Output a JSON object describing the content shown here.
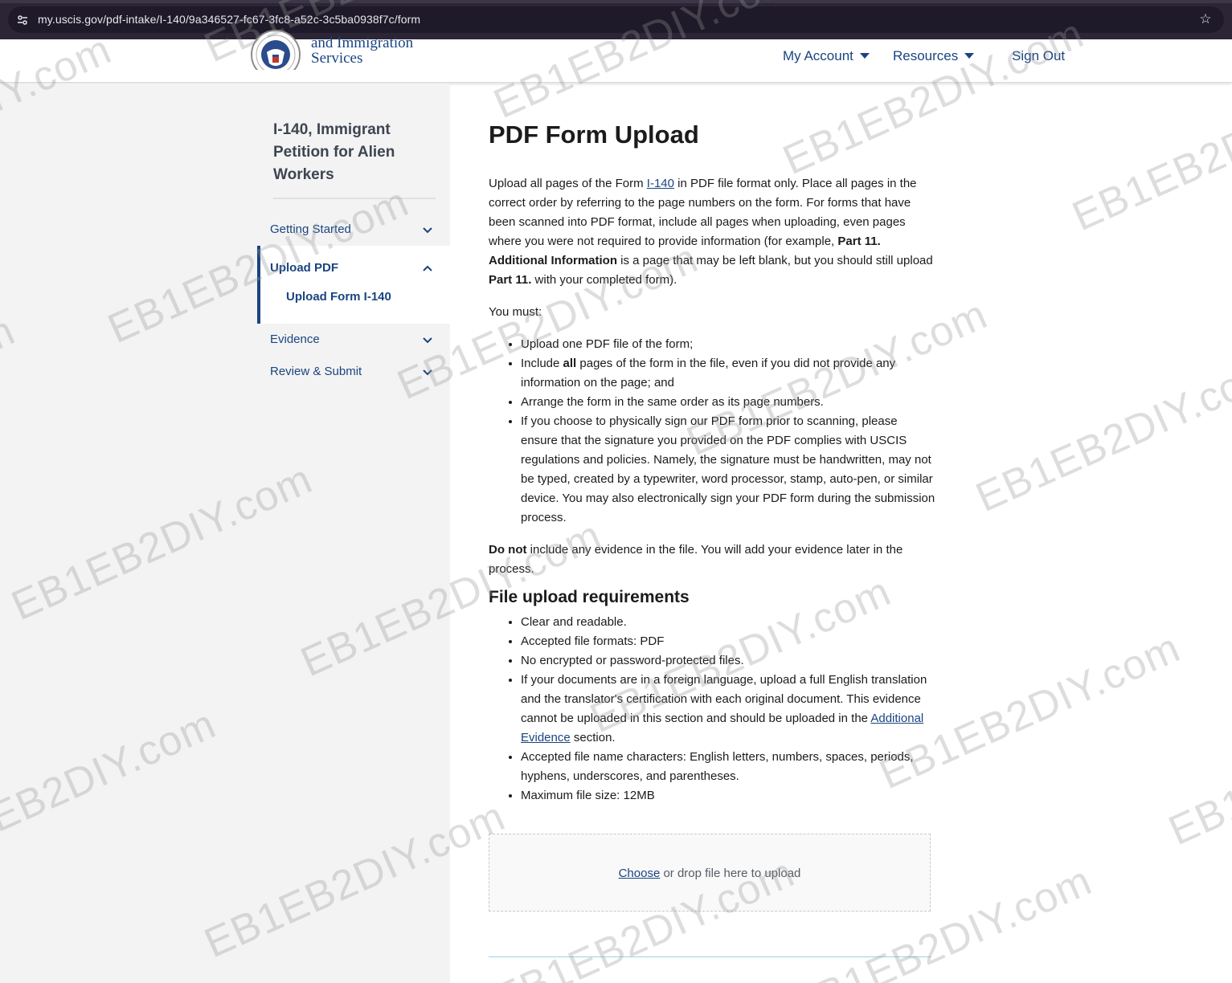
{
  "browser": {
    "url": "my.uscis.gov/pdf-intake/I-140/9a346527-fc67-3fc8-a52c-3c5ba0938f7c/form"
  },
  "header": {
    "logo_line1": "and Immigration",
    "logo_line2": "Services",
    "nav": {
      "my_account": "My Account",
      "resources": "Resources",
      "sign_out": "Sign Out"
    }
  },
  "sidebar": {
    "title": "I-140, Immigrant Petition for Alien Workers",
    "items": [
      {
        "label": "Getting Started"
      },
      {
        "label": "Upload PDF",
        "sub": "Upload Form I-140"
      },
      {
        "label": "Evidence"
      },
      {
        "label": "Review & Submit"
      }
    ]
  },
  "main": {
    "title": "PDF Form Upload",
    "intro": {
      "t1": "Upload all pages of the Form ",
      "link": "I-140",
      "t2": " in PDF file format only. Place all pages in the correct order by referring to the page numbers on the form. For forms that have been scanned into PDF format, include all pages when uploading, even pages where you were not required to provide information (for example, ",
      "b1": "Part 11. Additional Information",
      "t3": " is a page that may be left blank, but you should still upload ",
      "b2": "Part 11.",
      "t4": " with your completed form)."
    },
    "you_must": "You must:",
    "must_list": {
      "i1": "Upload one PDF file of the form;",
      "i2a": "Include ",
      "i2b": "all",
      "i2c": " pages of the form in the file, even if you did not provide any information on the page; and",
      "i3": "Arrange the form in the same order as its page numbers.",
      "i4": "If you choose to physically sign our PDF form prior to scanning, please ensure that the signature you provided on the PDF complies with USCIS regulations and policies. Namely, the signature must be handwritten, may not be typed, created by a typewriter, word processor, stamp, auto-pen, or similar device. You may also electronically sign your PDF form during the submission process."
    },
    "do_not": {
      "b": "Do not",
      "t": " include any evidence in the file. You will add your evidence later in the process."
    },
    "req_title": "File upload requirements",
    "req_list": {
      "r1": "Clear and readable.",
      "r2": "Accepted file formats: PDF",
      "r3": "No encrypted or password-protected files.",
      "r4a": "If your documents are in a foreign language, upload a full English translation and the translator's certification with each original document. This evidence cannot be uploaded in this section and should be uploaded in the ",
      "r4link": "Additional Evidence",
      "r4b": " section.",
      "r5": "Accepted file name characters: English letters, numbers, spaces, periods, hyphens, underscores, and parentheses.",
      "r6": "Maximum file size: 12MB"
    },
    "dropzone": {
      "link": "Choose",
      "text": " or drop file here to upload"
    }
  },
  "watermark": "EB1EB2DIY.com"
}
